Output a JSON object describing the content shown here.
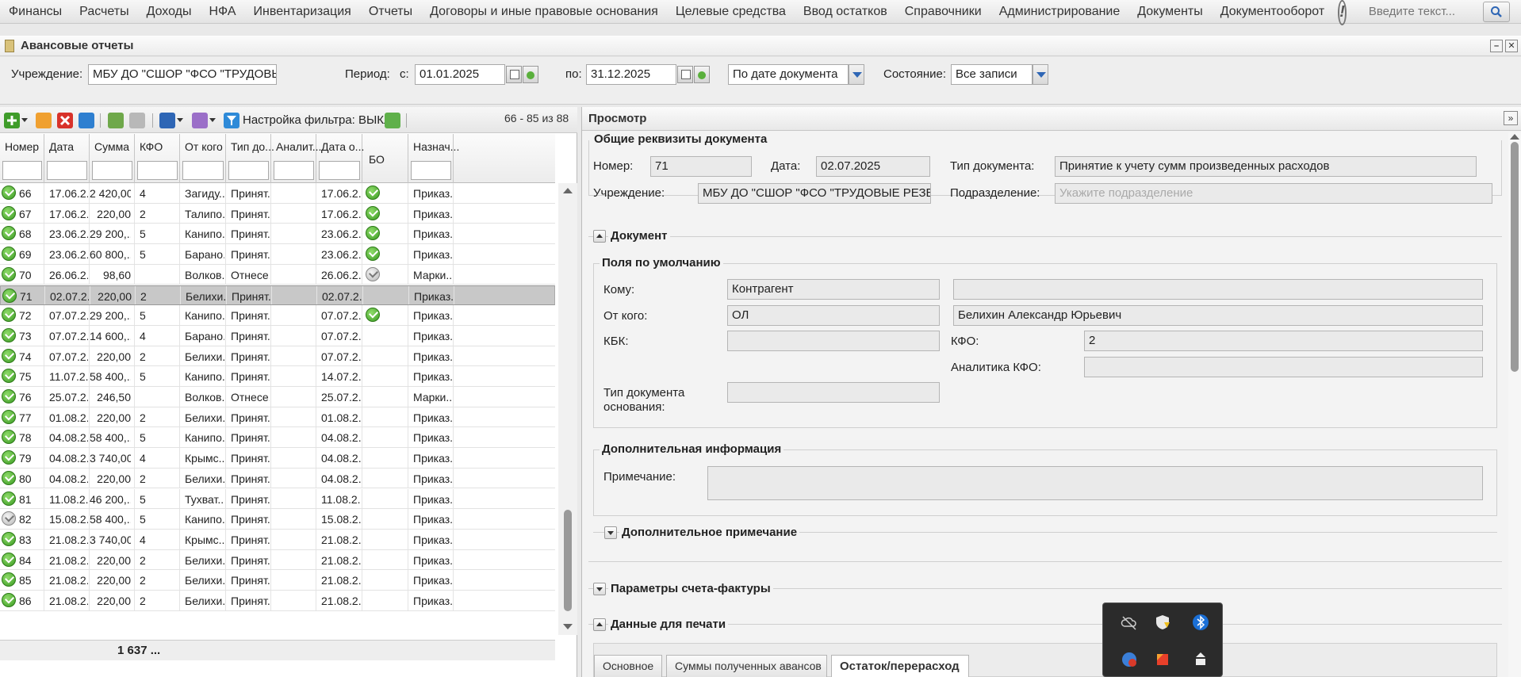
{
  "menu": {
    "items": [
      "Финансы",
      "Расчеты",
      "Доходы",
      "НФА",
      "Инвентаризация",
      "Отчеты",
      "Договоры и иные правовые основания",
      "Целевые средства",
      "Ввод остатков",
      "Справочники",
      "Администрирование",
      "Документы",
      "Документооборот"
    ],
    "warning_icon": "!",
    "search_placeholder": "Введите текст..."
  },
  "window": {
    "title": "Авансовые отчеты"
  },
  "filters": {
    "institution_label": "Учреждение:",
    "institution_value": "МБУ ДО \"СШОР \"ФСО \"ТРУДОВЫЕ РЕЗЕРВЫ\"",
    "period_label": "Период:",
    "from_label": "с:",
    "from_value": "01.01.2025",
    "to_label": "по:",
    "to_value": "31.12.2025",
    "date_mode": "По дате документа",
    "state_label": "Состояние:",
    "state_value": "Все записи"
  },
  "toolbar": {
    "filter_label": "Настройка фильтра: ВЫКЛ",
    "pager": "66 - 85 из 88"
  },
  "grid": {
    "columns": [
      "Номер",
      "Дата",
      "Сумма",
      "КФО",
      "От кого",
      "Тип до...",
      "Аналит...",
      "Дата о...",
      "БО",
      "Назнач..."
    ],
    "rows": [
      {
        "status": "ok",
        "num": "66",
        "date": "17.06.2...",
        "sum": "2 420,00",
        "kfo": "4",
        "from": "Загиду...",
        "type": "Принят...",
        "anal": "",
        "dateo": "17.06.2...",
        "bo": "ok",
        "purpose": "Приказ..."
      },
      {
        "status": "ok",
        "num": "67",
        "date": "17.06.2...",
        "sum": "220,00",
        "kfo": "2",
        "from": "Талипо...",
        "type": "Принят...",
        "anal": "",
        "dateo": "17.06.2...",
        "bo": "ok",
        "purpose": "Приказ..."
      },
      {
        "status": "ok",
        "num": "68",
        "date": "23.06.2...",
        "sum": "29 200,...",
        "kfo": "5",
        "from": "Канипо...",
        "type": "Принят...",
        "anal": "",
        "dateo": "23.06.2...",
        "bo": "ok",
        "purpose": "Приказ..."
      },
      {
        "status": "ok",
        "num": "69",
        "date": "23.06.2...",
        "sum": "60 800,...",
        "kfo": "5",
        "from": "Барано...",
        "type": "Принят...",
        "anal": "",
        "dateo": "23.06.2...",
        "bo": "ok",
        "purpose": "Приказ..."
      },
      {
        "status": "ok",
        "num": "70",
        "date": "26.06.2...",
        "sum": "98,60",
        "kfo": "",
        "from": "Волков...",
        "type": "Отнесе...",
        "anal": "",
        "dateo": "26.06.2...",
        "bo": "pend",
        "purpose": "Марки..."
      },
      {
        "status": "ok",
        "num": "71",
        "date": "02.07.2...",
        "sum": "220,00",
        "kfo": "2",
        "from": "Белихи...",
        "type": "Принят...",
        "anal": "",
        "dateo": "02.07.2...",
        "bo": "",
        "purpose": "Приказ...",
        "selected": true
      },
      {
        "status": "ok",
        "num": "72",
        "date": "07.07.2...",
        "sum": "29 200,...",
        "kfo": "5",
        "from": "Канипо...",
        "type": "Принят...",
        "anal": "",
        "dateo": "07.07.2...",
        "bo": "ok",
        "purpose": "Приказ..."
      },
      {
        "status": "ok",
        "num": "73",
        "date": "07.07.2...",
        "sum": "14 600,...",
        "kfo": "4",
        "from": "Барано...",
        "type": "Принят...",
        "anal": "",
        "dateo": "07.07.2...",
        "bo": "",
        "purpose": "Приказ..."
      },
      {
        "status": "ok",
        "num": "74",
        "date": "07.07.2...",
        "sum": "220,00",
        "kfo": "2",
        "from": "Белихи...",
        "type": "Принят...",
        "anal": "",
        "dateo": "07.07.2...",
        "bo": "",
        "purpose": "Приказ..."
      },
      {
        "status": "ok",
        "num": "75",
        "date": "11.07.2...",
        "sum": "58 400,...",
        "kfo": "5",
        "from": "Канипо...",
        "type": "Принят...",
        "anal": "",
        "dateo": "14.07.2...",
        "bo": "",
        "purpose": "Приказ..."
      },
      {
        "status": "ok",
        "num": "76",
        "date": "25.07.2...",
        "sum": "246,50",
        "kfo": "",
        "from": "Волков...",
        "type": "Отнесе...",
        "anal": "",
        "dateo": "25.07.2...",
        "bo": "",
        "purpose": "Марки..."
      },
      {
        "status": "ok",
        "num": "77",
        "date": "01.08.2...",
        "sum": "220,00",
        "kfo": "2",
        "from": "Белихи...",
        "type": "Принят...",
        "anal": "",
        "dateo": "01.08.2...",
        "bo": "",
        "purpose": "Приказ..."
      },
      {
        "status": "ok",
        "num": "78",
        "date": "04.08.2...",
        "sum": "58 400,...",
        "kfo": "5",
        "from": "Канипо...",
        "type": "Принят...",
        "anal": "",
        "dateo": "04.08.2...",
        "bo": "",
        "purpose": "Приказ..."
      },
      {
        "status": "ok",
        "num": "79",
        "date": "04.08.2...",
        "sum": "3 740,00",
        "kfo": "4",
        "from": "Крымс...",
        "type": "Принят...",
        "anal": "",
        "dateo": "04.08.2...",
        "bo": "",
        "purpose": "Приказ..."
      },
      {
        "status": "ok",
        "num": "80",
        "date": "04.08.2...",
        "sum": "220,00",
        "kfo": "2",
        "from": "Белихи...",
        "type": "Принят...",
        "anal": "",
        "dateo": "04.08.2...",
        "bo": "",
        "purpose": "Приказ..."
      },
      {
        "status": "ok",
        "num": "81",
        "date": "11.08.2...",
        "sum": "46 200,...",
        "kfo": "5",
        "from": "Тухват...",
        "type": "Принят...",
        "anal": "",
        "dateo": "11.08.2...",
        "bo": "",
        "purpose": "Приказ..."
      },
      {
        "status": "pend",
        "num": "82",
        "date": "15.08.2...",
        "sum": "58 400,...",
        "kfo": "5",
        "from": "Канипо...",
        "type": "Принят...",
        "anal": "",
        "dateo": "15.08.2...",
        "bo": "",
        "purpose": "Приказ..."
      },
      {
        "status": "ok",
        "num": "83",
        "date": "21.08.2...",
        "sum": "3 740,00",
        "kfo": "4",
        "from": "Крымс...",
        "type": "Принят...",
        "anal": "",
        "dateo": "21.08.2...",
        "bo": "",
        "purpose": "Приказ..."
      },
      {
        "status": "ok",
        "num": "84",
        "date": "21.08.2...",
        "sum": "220,00",
        "kfo": "2",
        "from": "Белихи...",
        "type": "Принят...",
        "anal": "",
        "dateo": "21.08.2...",
        "bo": "",
        "purpose": "Приказ..."
      },
      {
        "status": "ok",
        "num": "85",
        "date": "21.08.2...",
        "sum": "220,00",
        "kfo": "2",
        "from": "Белихи...",
        "type": "Принят...",
        "anal": "",
        "dateo": "21.08.2...",
        "bo": "",
        "purpose": "Приказ..."
      },
      {
        "status": "ok",
        "num": "86",
        "date": "21.08.2...",
        "sum": "220,00",
        "kfo": "2",
        "from": "Белихи...",
        "type": "Принят...",
        "anal": "",
        "dateo": "21.08.2...",
        "bo": "",
        "purpose": "Приказ..."
      }
    ],
    "total": "1 637 ..."
  },
  "view": {
    "title": "Просмотр",
    "general": {
      "title": "Общие реквизиты документа",
      "number_label": "Номер:",
      "number_value": "71",
      "date_label": "Дата:",
      "date_value": "02.07.2025",
      "doctype_label": "Тип документа:",
      "doctype_value": "Принятие к учету сумм произведенных расходов",
      "inst_label": "Учреждение:",
      "inst_value": "МБУ ДО \"СШОР \"ФСО \"ТРУДОВЫЕ РЕЗЕРВЫ\"",
      "subdiv_label": "Подразделение:",
      "subdiv_placeholder": "Укажите подразделение"
    },
    "document": {
      "title": "Документ",
      "defaults_title": "Поля по умолчанию",
      "to_label": "Кому:",
      "to_value": "Контрагент",
      "to_value2": "",
      "from_label": "От кого:",
      "from_value": "ОЛ",
      "from_value2": "Белихин Александр Юрьевич",
      "kbk_label": "КБК:",
      "kbk_value": "",
      "kfo_label": "КФО:",
      "kfo_value": "2",
      "kfo_anal_label": "Аналитика КФО:",
      "kfo_anal_value": "",
      "basis_label": "Тип документа основания:",
      "basis_value": "",
      "extra_title": "Дополнительная информация",
      "note_label": "Примечание:",
      "note_value": "",
      "extra_note_title": "Дополнительное примечание"
    },
    "invoice_title": "Параметры счета-фактуры",
    "print_title": "Данные для печати",
    "tabs": [
      "Основное",
      "Суммы полученных авансов",
      "Остаток/перерасход"
    ]
  },
  "colors": {
    "accent_blue": "#2e66b5",
    "ok_green": "#3a9a22",
    "selected_row": "#c8c8c8"
  }
}
